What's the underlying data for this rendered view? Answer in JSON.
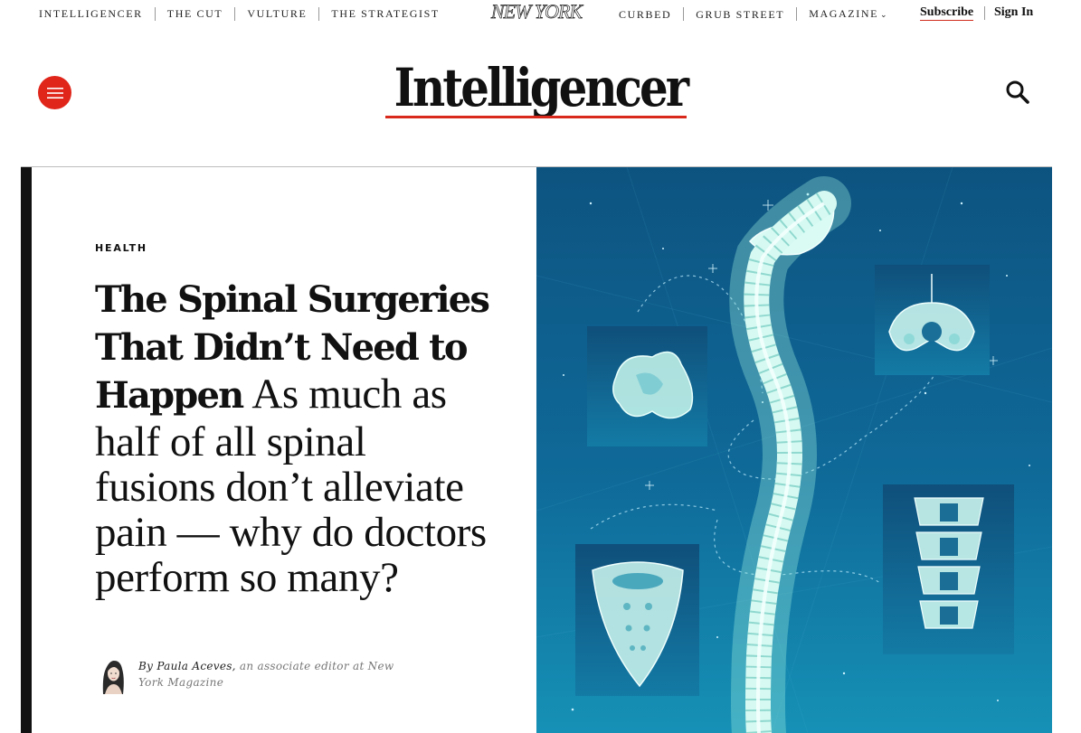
{
  "topnav": {
    "left_links": [
      "Intelligencer",
      "The Cut",
      "Vulture",
      "The Strategist"
    ],
    "logo": "NEW YORK",
    "right_links": [
      "Curbed",
      "Grub Street",
      "Magazine"
    ],
    "subscribe": "Subscribe",
    "sign_in": "Sign In"
  },
  "header": {
    "brand": "Intelligencer",
    "menu_icon": "hamburger-icon",
    "search_icon": "search-icon"
  },
  "article": {
    "rubric": "HEALTH",
    "headline": "The Spinal Surgeries That Didn’t Need to Happen",
    "dek": "As much as half of all spinal fusions don’t alleviate pain — why do doctors perform so many?",
    "byline_prefix": "By",
    "author": "Paula Aceves,",
    "author_desc": "an associate editor at New York Magazine"
  },
  "colors": {
    "accent_red": "#d9281c",
    "hero_blue": "#0e5f8c",
    "text": "#111111"
  }
}
